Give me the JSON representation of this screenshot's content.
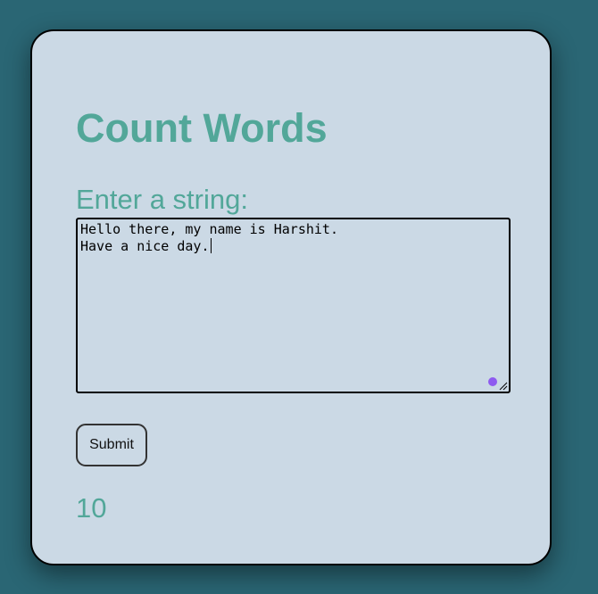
{
  "page": {
    "title": "Count Words",
    "input_label": "Enter a string:",
    "textarea_lines": [
      "Hello there, my name is Harshit.",
      "Have a nice day."
    ],
    "submit_label": "Submit",
    "result": "10"
  },
  "icons": {
    "grammarly": "grammarly-dot-icon",
    "resize": "resize-grip-icon"
  },
  "colors": {
    "background": "#2a6674",
    "card": "#cbd9e5",
    "accent": "#52a799",
    "grammarly": "#8e5bf0"
  }
}
